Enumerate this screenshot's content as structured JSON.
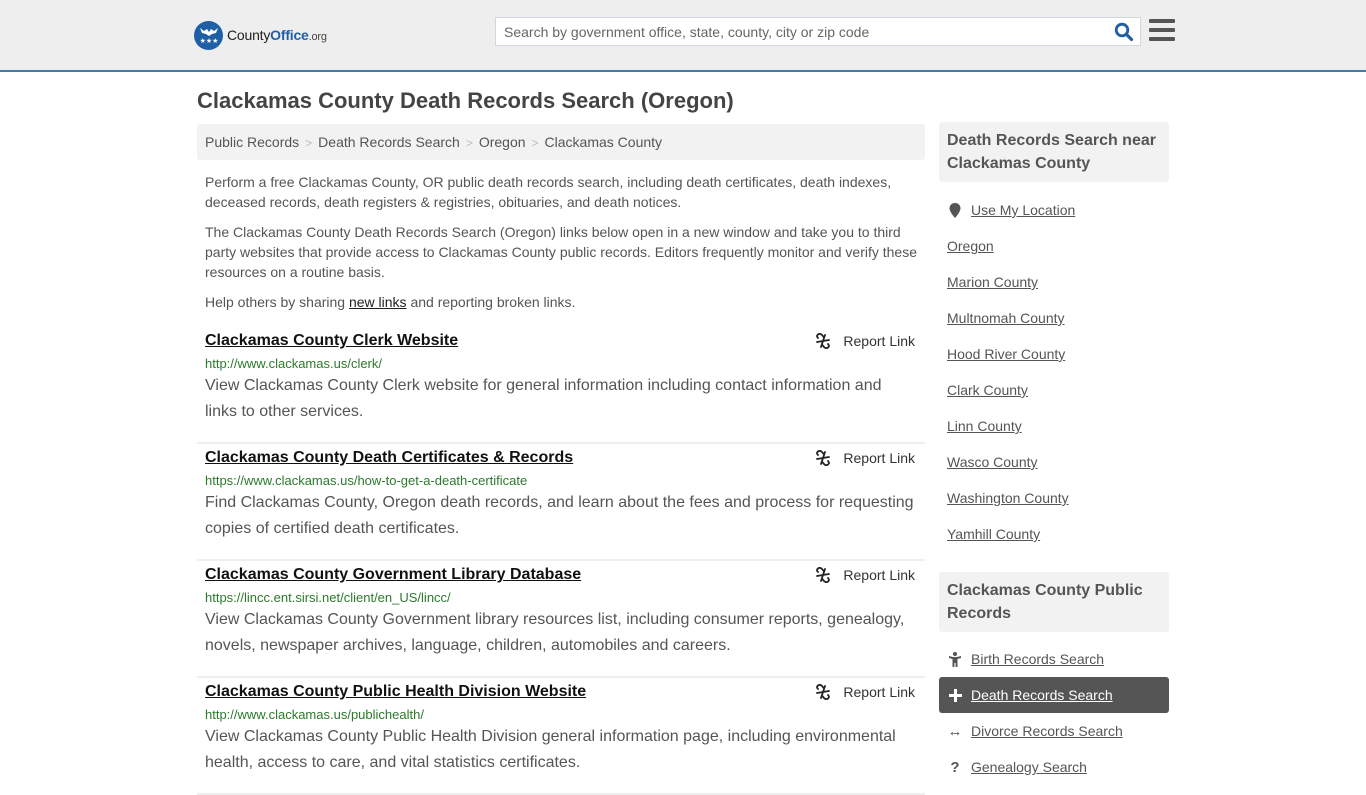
{
  "header": {
    "logo": {
      "prefix": "County",
      "brand": "Office",
      "suffix": ".org"
    },
    "search": {
      "placeholder": "Search by government office, state, county, city or zip code",
      "value": ""
    },
    "search_icon": "magnifier-icon",
    "menu_icon": "hamburger-menu-icon",
    "colors": {
      "brand": "#1f5fa6",
      "header_border": "#3b7db0"
    }
  },
  "page": {
    "title": "Clackamas County Death Records Search (Oregon)",
    "breadcrumb": [
      "Public Records",
      "Death Records Search",
      "Oregon",
      "Clackamas County"
    ],
    "intro": {
      "p1": "Perform a free Clackamas County, OR public death records search, including death certificates, death indexes, deceased records, death registers & registries, obituaries, and death notices.",
      "p2": "The Clackamas County Death Records Search (Oregon) links below open in a new window and take you to third party websites that provide access to Clackamas County public records. Editors frequently monitor and verify these resources on a routine basis.",
      "p3_before": "Help others by sharing ",
      "p3_link": "new links",
      "p3_after": " and reporting broken links."
    }
  },
  "results": [
    {
      "title": "Clackamas County Clerk Website",
      "url": "http://www.clackamas.us/clerk/",
      "description": "View Clackamas County Clerk website for general information including contact information and links to other services.",
      "report_label": "Report Link"
    },
    {
      "title": "Clackamas County Death Certificates & Records",
      "url": "https://www.clackamas.us/how-to-get-a-death-certificate",
      "description": "Find Clackamas County, Oregon death records, and learn about the fees and process for requesting copies of certified death certificates.",
      "report_label": "Report Link"
    },
    {
      "title": "Clackamas County Government Library Database",
      "url": "https://lincc.ent.sirsi.net/client/en_US/lincc/",
      "description": "View Clackamas County Government library resources list, including consumer reports, genealogy, novels, newspaper archives, language, children, automobiles and careers.",
      "report_label": "Report Link"
    },
    {
      "title": "Clackamas County Public Health Division Website",
      "url": "http://www.clackamas.us/publichealth/",
      "description": "View Clackamas County Public Health Division general information page, including environmental health, access to care, and vital statistics certificates.",
      "report_label": "Report Link"
    }
  ],
  "sidebar": {
    "nearby": {
      "heading": "Death Records Search near Clackamas County",
      "use_location": "Use My Location",
      "items": [
        "Oregon",
        "Marion County",
        "Multnomah County",
        "Hood River County",
        "Clark County",
        "Linn County",
        "Wasco County",
        "Washington County",
        "Yamhill County"
      ]
    },
    "public_records": {
      "heading": "Clackamas County Public Records",
      "items": [
        {
          "label": "Birth Records Search",
          "icon": "child-icon",
          "active": false
        },
        {
          "label": "Death Records Search",
          "icon": "plus-icon",
          "active": true
        },
        {
          "label": "Divorce Records Search",
          "icon": "double-arrow-icon",
          "active": false
        },
        {
          "label": "Genealogy Search",
          "icon": "question-icon",
          "active": false
        }
      ]
    }
  }
}
